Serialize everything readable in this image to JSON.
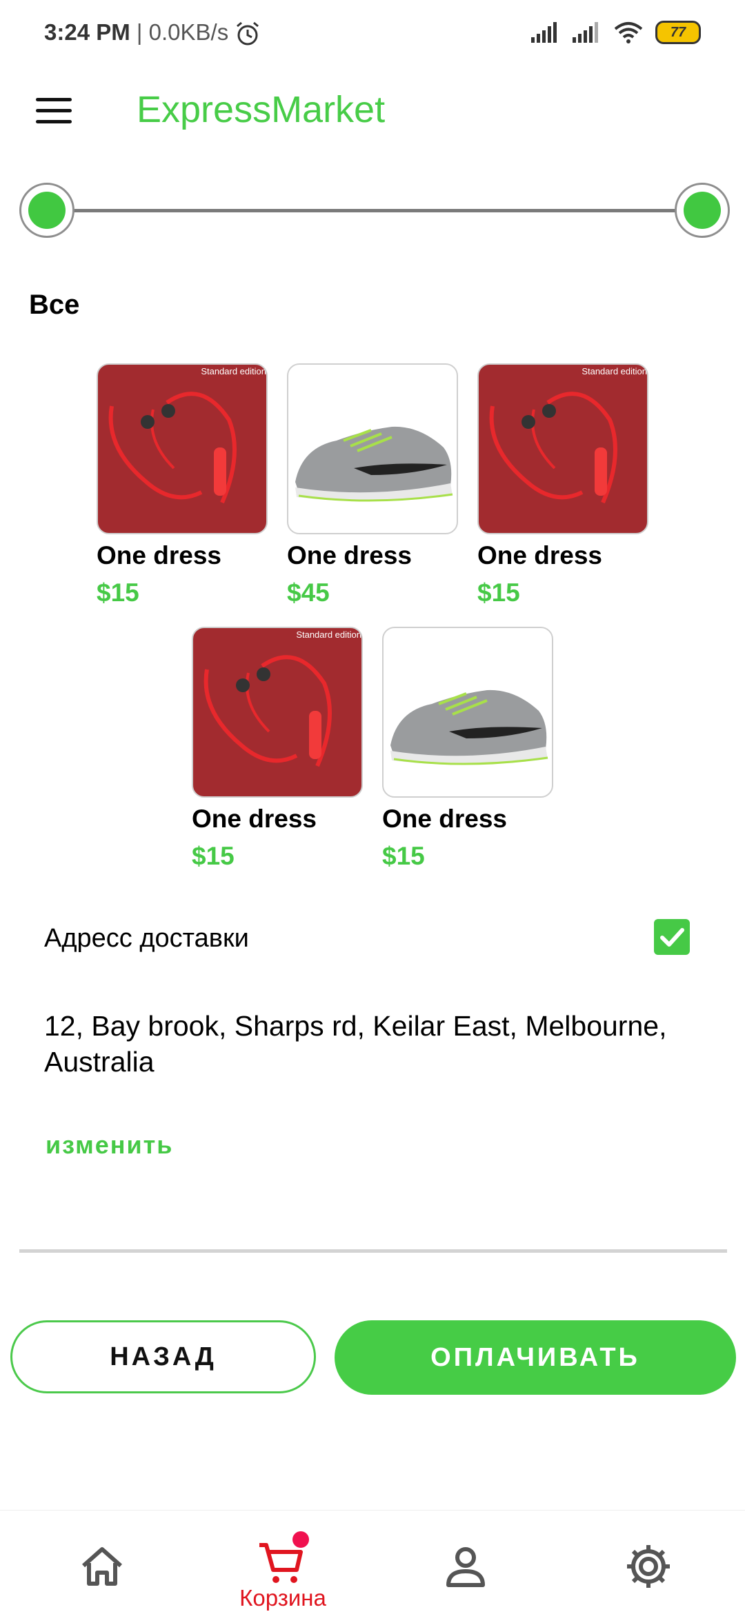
{
  "status_bar": {
    "time": "3:24 PM",
    "separator": "|",
    "net_speed": "0.0KB/s",
    "battery": "77"
  },
  "app": {
    "title": "ExpressMarket"
  },
  "section": {
    "title": "Все"
  },
  "products": [
    {
      "name": "One dress",
      "price": "$15",
      "image": "red-neckband-earphones",
      "caption": "Standard edition"
    },
    {
      "name": "One dress",
      "price": "$45",
      "image": "gray-running-shoe"
    },
    {
      "name": "One dress",
      "price": "$15",
      "image": "red-neckband-earphones",
      "caption": "Standard edition"
    },
    {
      "name": "One dress",
      "price": "$15",
      "image": "red-neckband-earphones",
      "caption": "Standard edition"
    },
    {
      "name": "One dress",
      "price": "$15",
      "image": "gray-running-shoe"
    }
  ],
  "delivery": {
    "label": "Адресс доставки",
    "checked": true,
    "address": "12, Bay brook, Sharps rd, Keilar East, Melbourne, Australia",
    "change_label": "изменить"
  },
  "actions": {
    "back_label": "НАЗАД",
    "pay_label": "ОПЛАЧИВАТЬ"
  },
  "bottom_nav": {
    "items": [
      {
        "icon": "home-icon"
      },
      {
        "icon": "cart-icon",
        "label": "Корзина",
        "active": true
      },
      {
        "icon": "profile-icon"
      },
      {
        "icon": "settings-icon"
      }
    ]
  },
  "colors": {
    "accent": "#46cc46",
    "active_nav": "#e0151f"
  }
}
